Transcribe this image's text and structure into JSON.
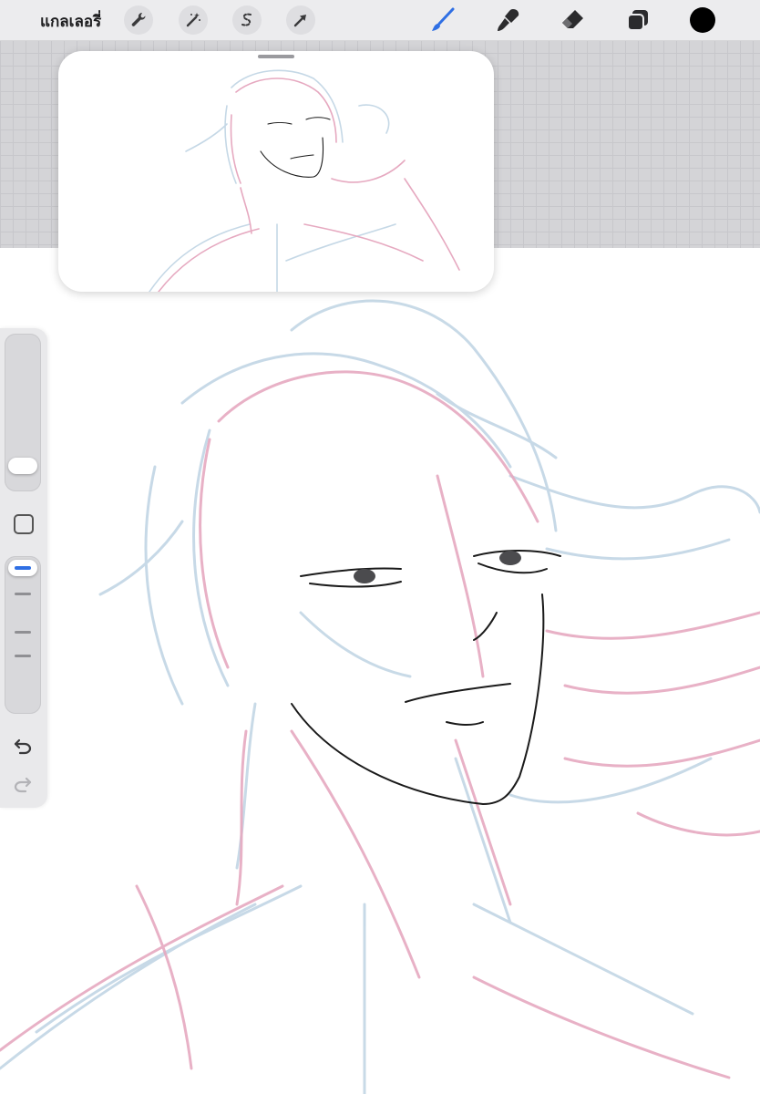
{
  "toolbar": {
    "gallery_label": "แกลเลอรี่",
    "left_tools": [
      {
        "icon": "wrench-icon",
        "name": "actions-button"
      },
      {
        "icon": "magic-wand-icon",
        "name": "adjustments-button"
      },
      {
        "icon": "selection-s-icon",
        "name": "selection-button"
      },
      {
        "icon": "arrow-cursor-icon",
        "name": "transform-button"
      }
    ],
    "right_tools": [
      {
        "icon": "brush-icon",
        "name": "paint-tool-button",
        "active": true
      },
      {
        "icon": "smudge-icon",
        "name": "smudge-tool-button"
      },
      {
        "icon": "eraser-icon",
        "name": "eraser-tool-button"
      },
      {
        "icon": "layers-icon",
        "name": "layers-button"
      }
    ],
    "current_color": "#000000",
    "active_tool_color": "#2f6fe4"
  },
  "colors": {
    "sketch_pink": "#e6a9c0",
    "sketch_blue": "#c5d8e6",
    "line_art": "#1a1a1a"
  },
  "sidebar": {
    "brush_size_level": 0.1,
    "opacity_level": 1.0,
    "icons": [
      "modify-square-icon",
      "undo-icon",
      "redo-icon"
    ]
  },
  "reference_window": {
    "visible": true
  }
}
